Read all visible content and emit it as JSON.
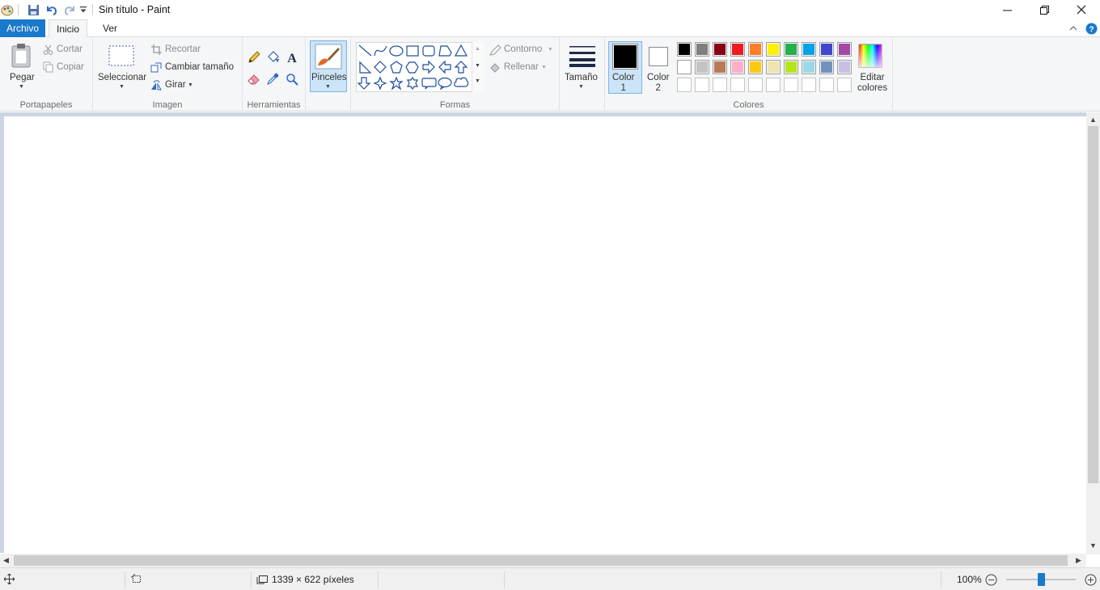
{
  "window": {
    "title": "Sin título - Paint",
    "icons": [
      "paint-app-icon",
      "save-icon",
      "undo-icon",
      "redo-icon",
      "customize-quick-access-icon",
      "minimize-icon",
      "maximize-icon",
      "close-icon",
      "help-icon"
    ]
  },
  "tabs": {
    "file": "Archivo",
    "home": "Inicio",
    "view": "Ver"
  },
  "clipboard": {
    "paste": "Pegar",
    "cut": "Cortar",
    "copy": "Copiar",
    "group": "Portapapeles"
  },
  "image": {
    "select": "Seleccionar",
    "crop": "Recortar",
    "resize": "Cambiar tamaño",
    "rotate": "Girar",
    "group": "Imagen"
  },
  "tools": {
    "group": "Herramientas",
    "icons": [
      "pencil-icon",
      "fill-bucket-icon",
      "text-icon",
      "eraser-icon",
      "color-picker-icon",
      "magnifier-icon"
    ]
  },
  "brushes": {
    "label": "Pinceles"
  },
  "shapes": {
    "group": "Formas",
    "outline": "Contorno",
    "fill": "Rellenar",
    "items": [
      "line",
      "curve",
      "oval",
      "rectangle",
      "rounded-rectangle",
      "polygon",
      "triangle",
      "right-triangle",
      "diamond",
      "pentagon",
      "hexagon",
      "right-arrow",
      "left-arrow",
      "up-arrow",
      "down-arrow",
      "four-point-star",
      "five-point-star",
      "six-point-star",
      "rounded-callout",
      "oval-callout",
      "cloud-callout"
    ]
  },
  "size": {
    "label": "Tamaño"
  },
  "colors": {
    "color1": "Color\n1",
    "color1_value": "#000000",
    "color2": "Color\n2",
    "color2_value": "#ffffff",
    "group": "Colores",
    "edit": "Editar\ncolores",
    "palette_row1": [
      "#000000",
      "#7f7f7f",
      "#880015",
      "#ed1c24",
      "#ff7f27",
      "#fff200",
      "#22b14c",
      "#00a2e8",
      "#3f48cc",
      "#a349a4"
    ],
    "palette_row2": [
      "#ffffff",
      "#c3c3c3",
      "#b97a57",
      "#ffaec9",
      "#ffc90e",
      "#efe4b0",
      "#b5e61d",
      "#99d9ea",
      "#7092be",
      "#c8bfe7"
    ],
    "palette_row3": [
      "",
      "",
      "",
      "",
      "",
      "",
      "",
      "",
      "",
      ""
    ]
  },
  "status": {
    "dimensions": "1339 × 622 píxeles",
    "zoom": "100%",
    "zoom_level_percent": 100
  }
}
